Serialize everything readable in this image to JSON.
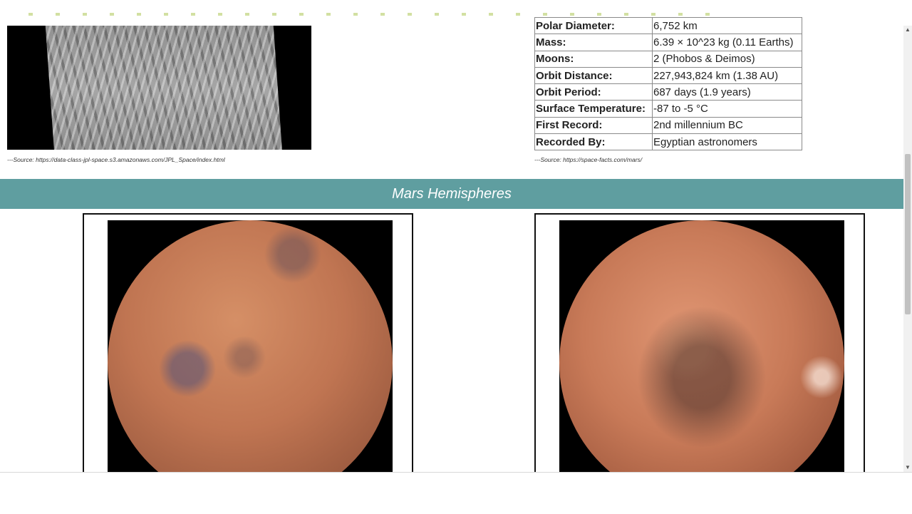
{
  "facts_table": {
    "rows": [
      {
        "key": "Polar Diameter:",
        "value": "6,752 km"
      },
      {
        "key": "Mass:",
        "value": "6.39 × 10^23 kg (0.11 Earths)"
      },
      {
        "key": "Moons:",
        "value": "2 (Phobos & Deimos)"
      },
      {
        "key": "Orbit Distance:",
        "value": "227,943,824 km (1.38 AU)"
      },
      {
        "key": "Orbit Period:",
        "value": "687 days (1.9 years)"
      },
      {
        "key": "Surface Temperature:",
        "value": "-87 to -5 °C"
      },
      {
        "key": "First Record:",
        "value": "2nd millennium BC"
      },
      {
        "key": "Recorded By:",
        "value": "Egyptian astronomers"
      }
    ],
    "source": "---Source: https://space-facts.com/mars/"
  },
  "featured_image": {
    "source": "---Source: https://data-class-jpl-space.s3.amazonaws.com/JPL_Space/index.html"
  },
  "hemispheres": {
    "title": "Mars Hemispheres"
  },
  "colors": {
    "banner": "#5f9ea0",
    "banner_text": "#ffffff"
  }
}
